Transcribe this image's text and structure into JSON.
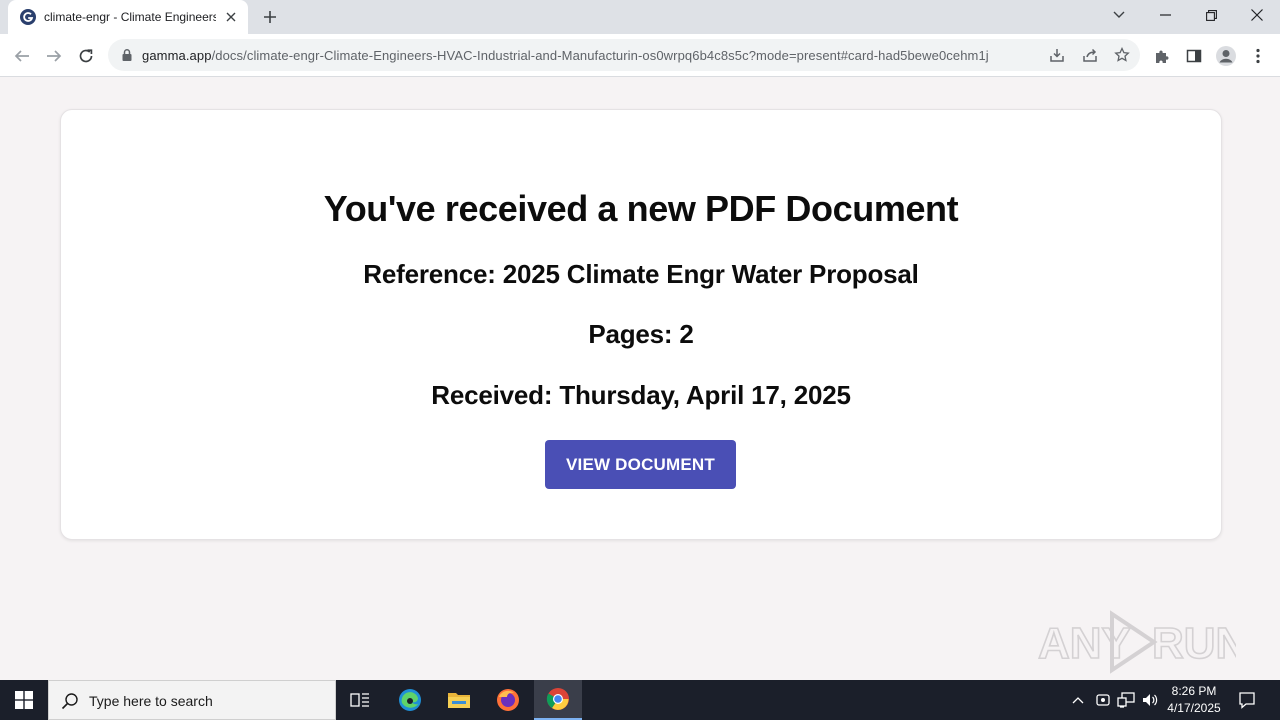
{
  "browser": {
    "tab": {
      "title": "climate-engr - Climate Engineers"
    },
    "address_bar": {
      "host": "gamma.app",
      "path": "/docs/climate-engr-Climate-Engineers-HVAC-Industrial-and-Manufacturin-os0wrpq6b4c8s5c?mode=present#card-had5bewe0cehm1j"
    }
  },
  "page": {
    "title": "You've received a new PDF Document",
    "reference": "Reference: 2025 Climate Engr Water Proposal",
    "pages": "Pages: 2",
    "received": "Received: Thursday, April 17, 2025",
    "button_label": "VIEW DOCUMENT",
    "button_color": "#4a4fb5"
  },
  "watermark": {
    "text": "ANY RUN"
  },
  "taskbar": {
    "search_placeholder": "Type here to search",
    "apps": [
      "task-view-icon",
      "edge-icon",
      "file-explorer-icon",
      "firefox-icon",
      "chrome-icon"
    ],
    "clock": {
      "time": "8:26 PM",
      "date": "4/17/2025"
    }
  }
}
